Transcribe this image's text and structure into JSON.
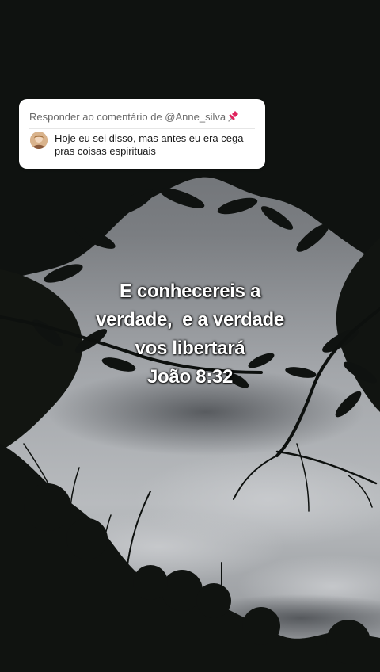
{
  "reply_card": {
    "prefix": "Responder ao comentário de ",
    "handle": "@Anne_silva",
    "pin_icon": "pushpin-icon",
    "avatar_icon": "user-avatar",
    "comment_line1": "Hoje eu sei disso, mas antes eu era cega",
    "comment_line2": "pras coisas espirituais"
  },
  "verse": {
    "line1": "E conhecereis a",
    "line2": "verdade,  e a verdade",
    "line3": "vos libertará",
    "line4": "João 8:32"
  },
  "colors": {
    "sky": "#8f9296",
    "foliage": "#0f1210",
    "card_bg": "#ffffff",
    "header_text": "#6b6b6b",
    "comment_text": "#1a1a1a",
    "verse_text": "#ffffff"
  }
}
